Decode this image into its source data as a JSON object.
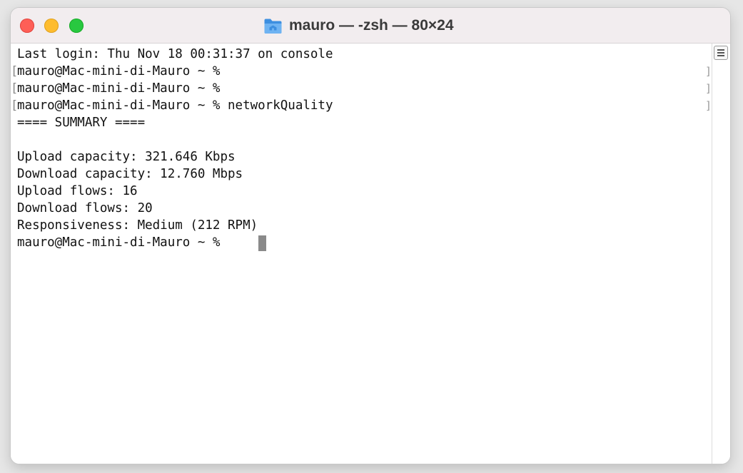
{
  "window": {
    "title": "mauro — -zsh — 80×24"
  },
  "icons": {
    "title_icon": "folder-icon",
    "marks_button": "list-icon",
    "cursor": "block-cursor"
  },
  "colors": {
    "close": "#fe5f57",
    "minimize": "#febc2e",
    "zoom": "#28c840",
    "folder": "#3d8fe0",
    "cursor": "#8a8a8a"
  },
  "terminal": {
    "lines": [
      "Last login: Thu Nov 18 00:31:37 on console",
      "mauro@Mac-mini-di-Mauro ~ %",
      "mauro@Mac-mini-di-Mauro ~ %",
      "mauro@Mac-mini-di-Mauro ~ % networkQuality",
      "==== SUMMARY ====",
      "",
      "Upload capacity: 321.646 Kbps",
      "Download capacity: 12.760 Mbps",
      "Upload flows: 16",
      "Download flows: 20",
      "Responsiveness: Medium (212 RPM)",
      "mauro@Mac-mini-di-Mauro ~ %"
    ],
    "mark_left": "[",
    "mark_right": "]"
  }
}
